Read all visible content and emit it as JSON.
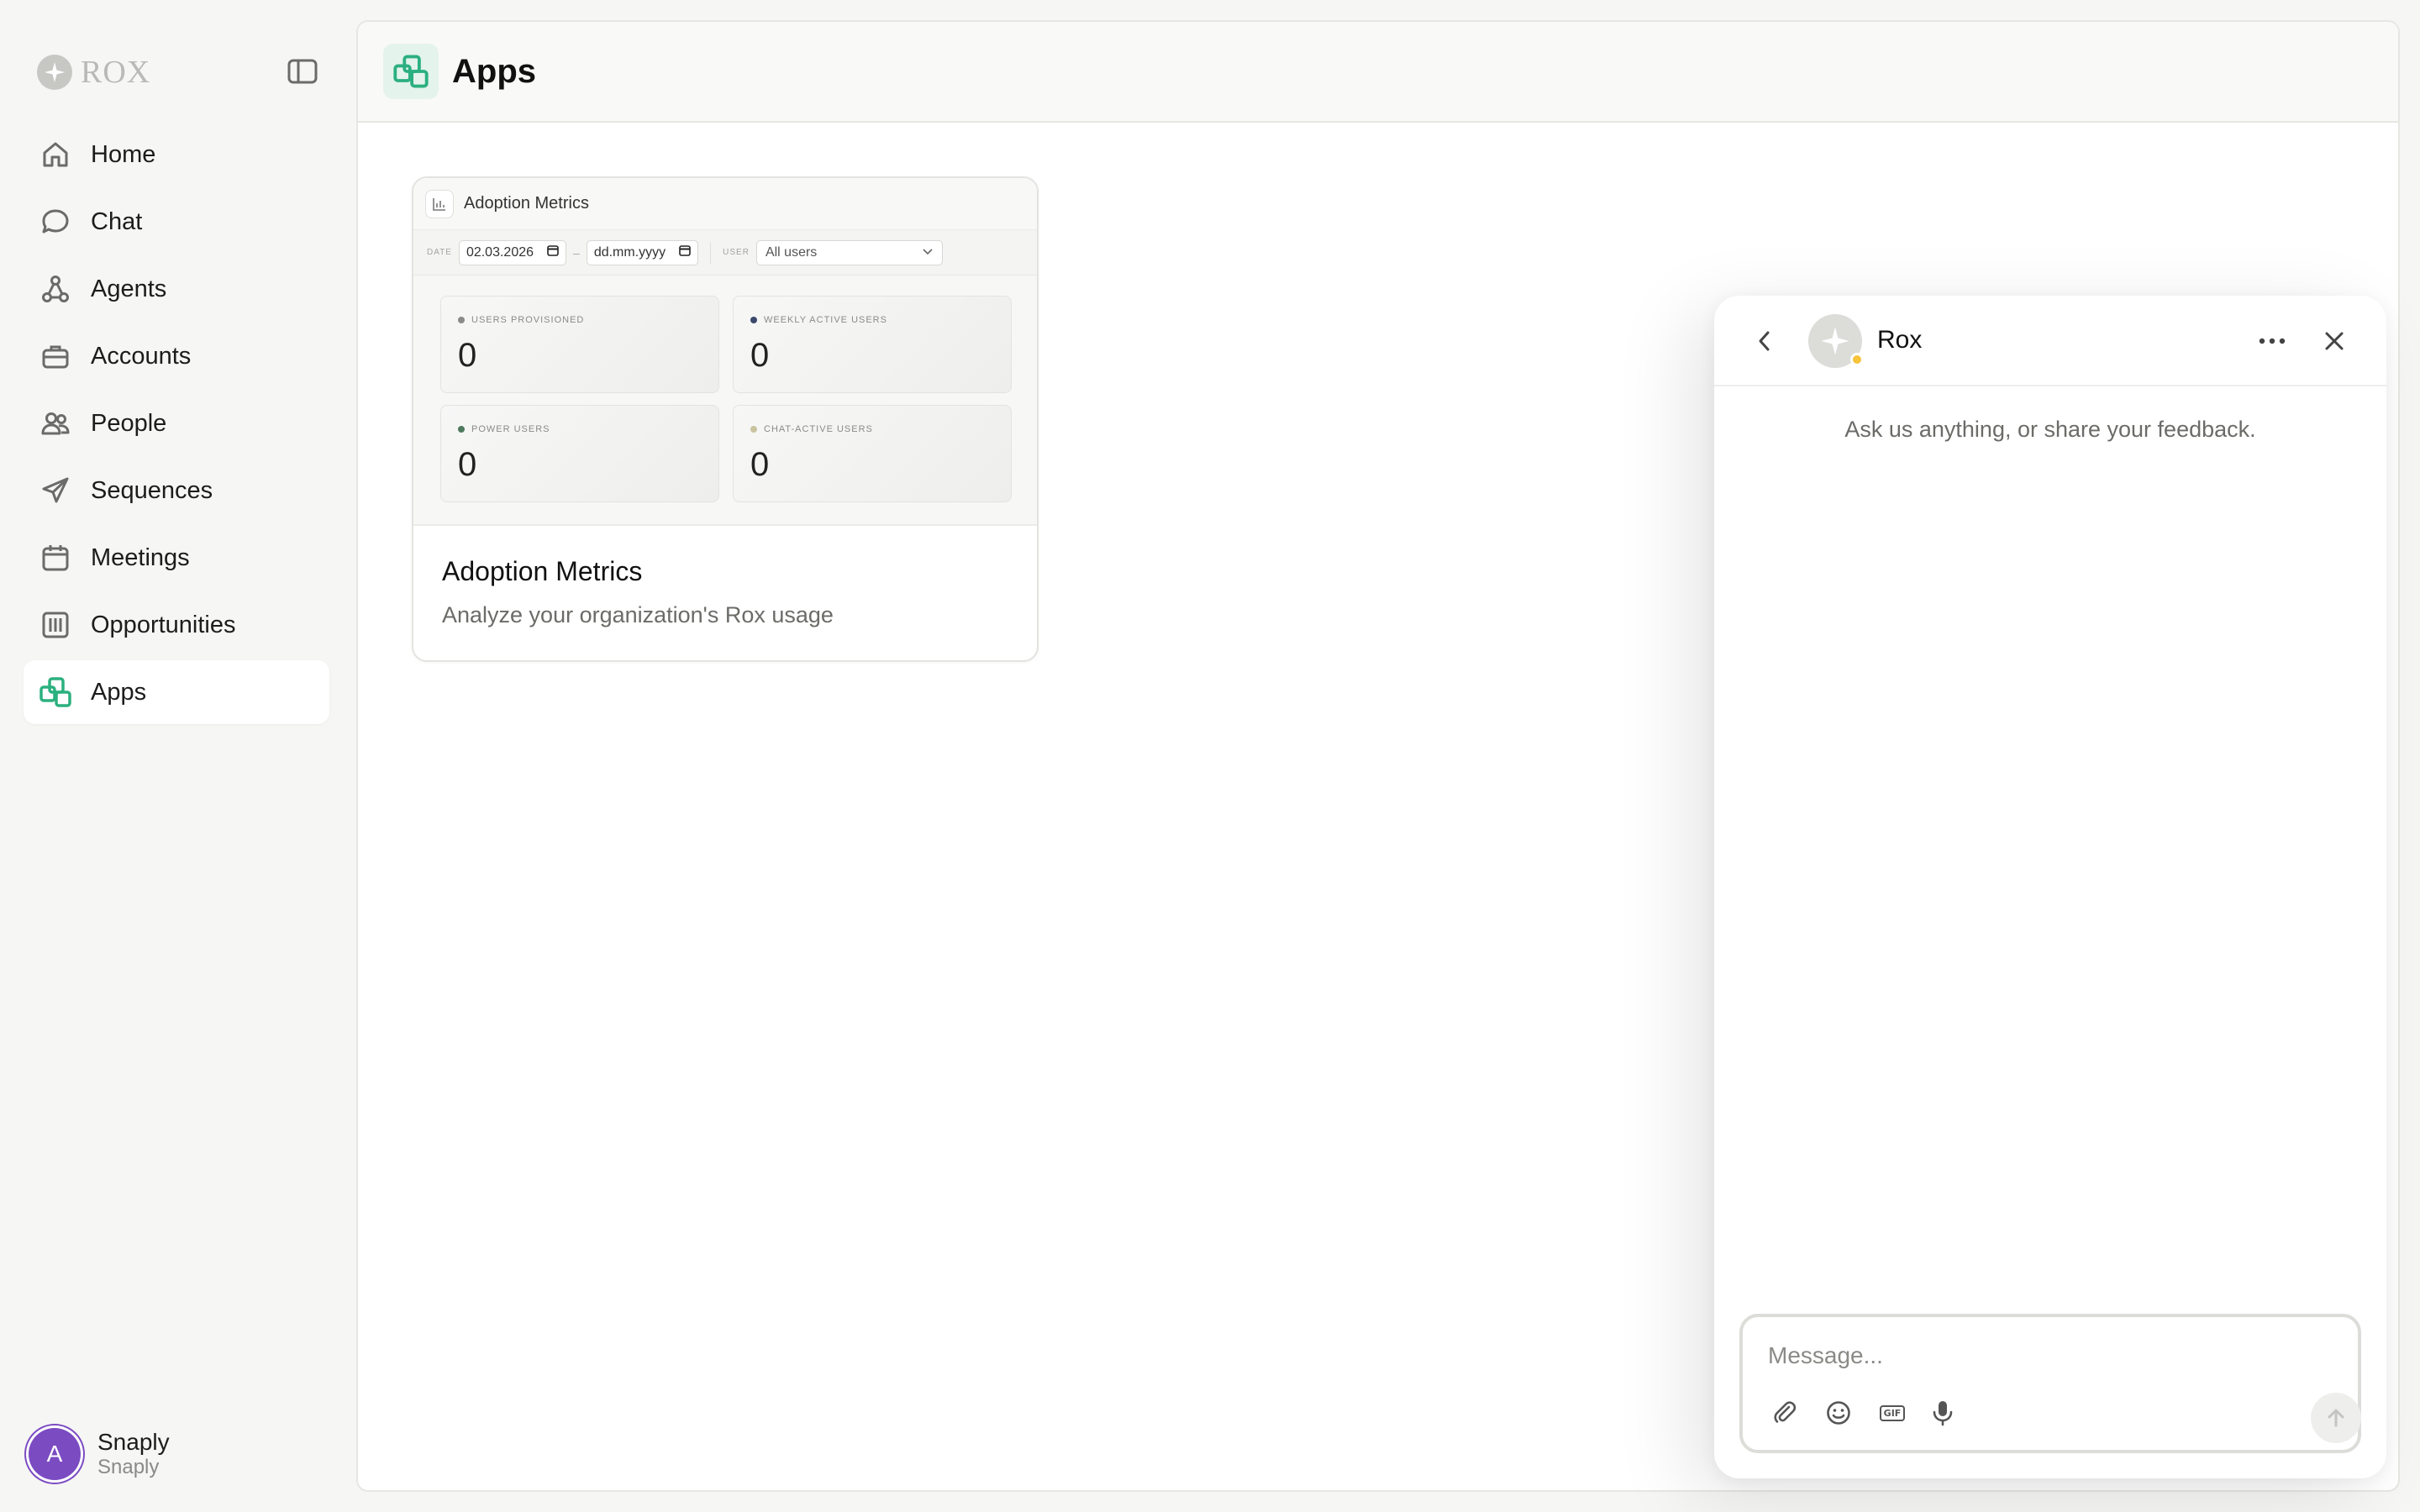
{
  "brand": {
    "name": "ROX"
  },
  "sidebar": {
    "items": [
      {
        "label": "Home",
        "icon": "home-icon",
        "active": false
      },
      {
        "label": "Chat",
        "icon": "chat-bubble-icon",
        "active": false
      },
      {
        "label": "Agents",
        "icon": "agents-icon",
        "active": false
      },
      {
        "label": "Accounts",
        "icon": "briefcase-icon",
        "active": false
      },
      {
        "label": "People",
        "icon": "people-icon",
        "active": false
      },
      {
        "label": "Sequences",
        "icon": "paper-plane-icon",
        "active": false
      },
      {
        "label": "Meetings",
        "icon": "calendar-icon",
        "active": false
      },
      {
        "label": "Opportunities",
        "icon": "columns-icon",
        "active": false
      },
      {
        "label": "Apps",
        "icon": "apps-icon",
        "active": true
      }
    ],
    "user": {
      "initial": "A",
      "name": "Snaply",
      "org": "Snaply"
    }
  },
  "main": {
    "title": "Apps",
    "app_card": {
      "title": "Adoption Metrics",
      "description": "Analyze your organization's Rox usage",
      "preview": {
        "title": "Adoption Metrics",
        "date_label": "DATE",
        "date_from": "02.03.2026",
        "date_sep": "–",
        "date_to": "dd.mm.yyyy",
        "user_label": "USER",
        "user_select": "All users",
        "metrics": [
          {
            "label": "USERS PROVISIONED",
            "value": "0",
            "dot_color": "#8a8a87"
          },
          {
            "label": "WEEKLY ACTIVE USERS",
            "value": "0",
            "dot_color": "#3b4a6b"
          },
          {
            "label": "POWER USERS",
            "value": "0",
            "dot_color": "#4e7a5e"
          },
          {
            "label": "CHAT-ACTIVE USERS",
            "value": "0",
            "dot_color": "#c9c3a0"
          }
        ]
      }
    }
  },
  "chat": {
    "name": "Rox",
    "status_color": "#f6c33a",
    "intro": "Ask us anything, or share your feedback.",
    "composer": {
      "placeholder": "Message...",
      "tools": [
        "paperclip-icon",
        "emoji-icon",
        "gif-icon",
        "microphone-icon"
      ],
      "gif_label": "GIF"
    }
  },
  "colors": {
    "accent": "#2bb07f",
    "active_bg": "#ffffff",
    "avatar": "#7b4bc2"
  }
}
